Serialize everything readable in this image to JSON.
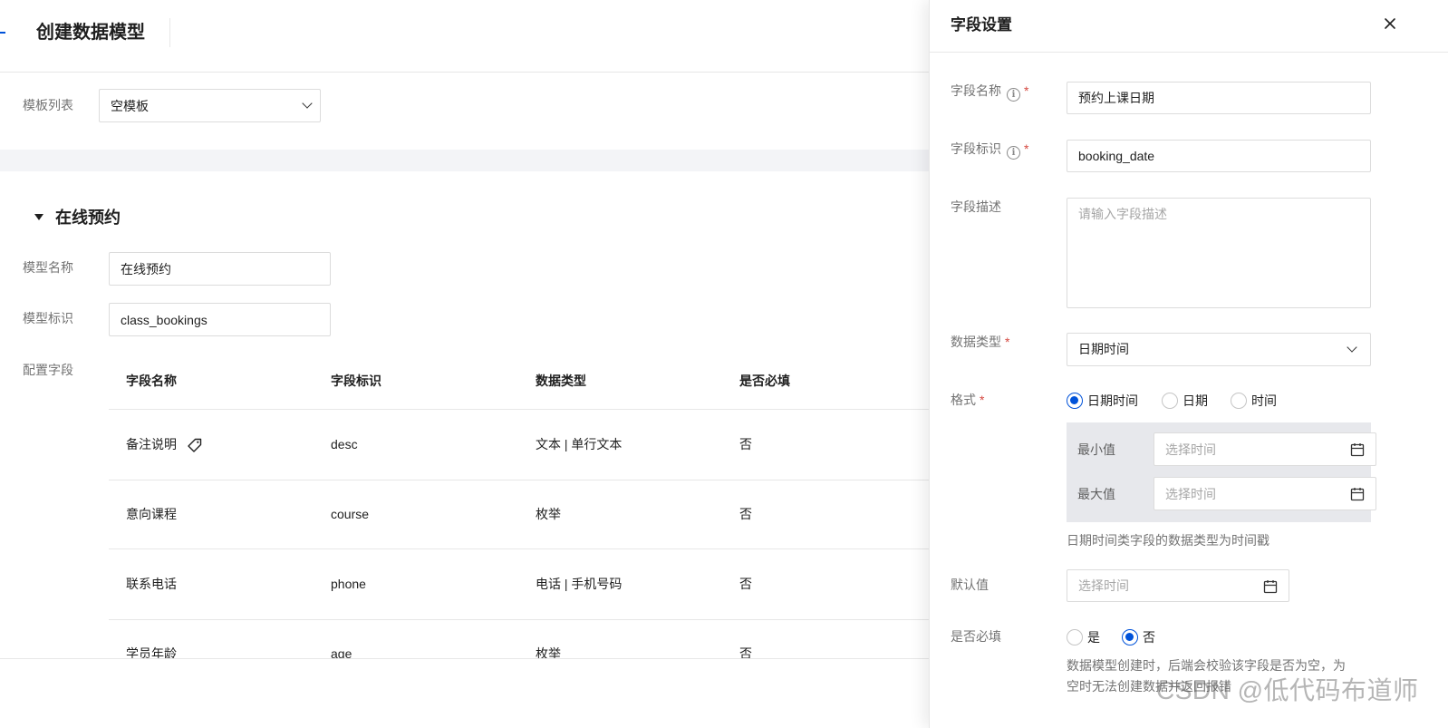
{
  "page": {
    "title": "创建数据模型",
    "template_label": "模板列表",
    "template_value": "空模板",
    "section_title": "在线预约",
    "model_name_label": "模型名称",
    "model_name_value": "在线预约",
    "model_id_label": "模型标识",
    "model_id_value": "class_bookings",
    "fields_label": "配置字段",
    "table": {
      "headers": [
        "字段名称",
        "字段标识",
        "数据类型",
        "是否必填"
      ],
      "rows": [
        {
          "name": "备注说明",
          "id": "desc",
          "type": "文本 | 单行文本",
          "required": "否"
        },
        {
          "name": "意向课程",
          "id": "course",
          "type": "枚举",
          "required": "否"
        },
        {
          "name": "联系电话",
          "id": "phone",
          "type": "电话 | 手机号码",
          "required": "否"
        },
        {
          "name": "学员年龄",
          "id": "age",
          "type": "枚举",
          "required": "否"
        }
      ]
    }
  },
  "drawer": {
    "title": "字段设置",
    "field_name_label": "字段名称",
    "field_name_value": "预约上课日期",
    "field_id_label": "字段标识",
    "field_id_value": "booking_date",
    "desc_label": "字段描述",
    "desc_placeholder": "请输入字段描述",
    "data_type_label": "数据类型",
    "data_type_value": "日期时间",
    "format_label": "格式",
    "format_options": [
      "日期时间",
      "日期",
      "时间"
    ],
    "format_selected": "日期时间",
    "min_label": "最小值",
    "max_label": "最大值",
    "time_placeholder": "选择时间",
    "format_hint": "日期时间类字段的数据类型为时间戳",
    "default_label": "默认值",
    "required_label": "是否必填",
    "required_options": [
      "是",
      "否"
    ],
    "required_selected": "否",
    "required_hint_1": "数据模型创建时，后端会校验该字段是否为空，为",
    "required_hint_2": "空时无法创建数据并返回报错"
  },
  "watermark": "CSDN @低代码布道师",
  "colors": {
    "primary": "#0052d9",
    "required_star": "#d54941"
  }
}
